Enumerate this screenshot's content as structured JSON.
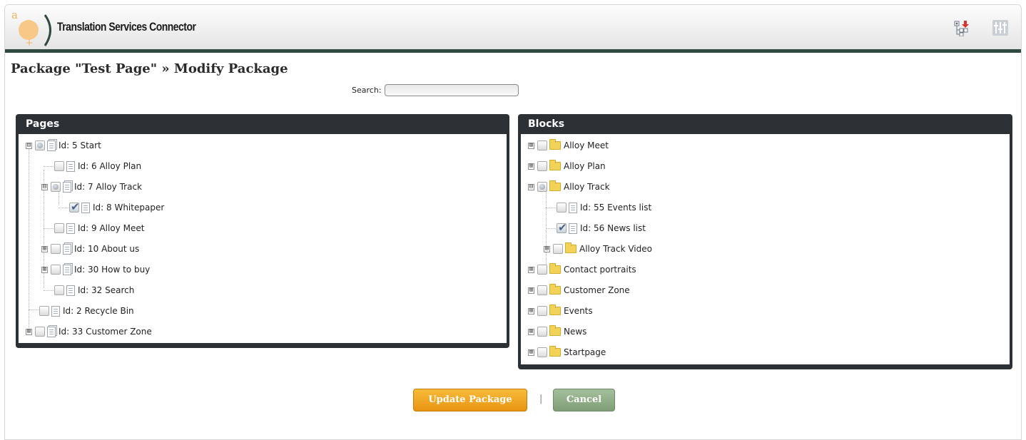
{
  "header": {
    "app_title": "Translation Services Connector",
    "logo_letter": "a",
    "icons": [
      "tree-download-icon",
      "settings-sliders-icon"
    ]
  },
  "page": {
    "title": "Package \"Test Page\" » Modify Package",
    "search_label": "Search:",
    "search_value": ""
  },
  "pages_panel": {
    "title": "Pages",
    "nodes": [
      {
        "label": "Id: 5 Start",
        "expander": "⊟",
        "check": "partial",
        "icon": "multi-page-icon"
      },
      {
        "label": "Id: 6 Alloy Plan",
        "expander": "",
        "check": "none",
        "icon": "page-icon"
      },
      {
        "label": "Id: 7 Alloy Track",
        "expander": "⊟",
        "check": "partial",
        "icon": "multi-page-icon"
      },
      {
        "label": "Id: 8 Whitepaper",
        "expander": "",
        "check": "checked",
        "icon": "page-icon"
      },
      {
        "label": "Id: 9 Alloy Meet",
        "expander": "",
        "check": "none",
        "icon": "page-icon"
      },
      {
        "label": "Id: 10 About us",
        "expander": "⊞",
        "check": "none",
        "icon": "multi-page-icon"
      },
      {
        "label": "Id: 30 How to buy",
        "expander": "⊞",
        "check": "none",
        "icon": "multi-page-icon"
      },
      {
        "label": "Id: 32 Search",
        "expander": "",
        "check": "none",
        "icon": "page-icon"
      },
      {
        "label": "Id: 2 Recycle Bin",
        "expander": "",
        "check": "none",
        "icon": "page-icon"
      },
      {
        "label": "Id: 33 Customer Zone",
        "expander": "⊞",
        "check": "none",
        "icon": "multi-page-icon"
      }
    ]
  },
  "blocks_panel": {
    "title": "Blocks",
    "nodes": [
      {
        "label": "Alloy Meet",
        "expander": "⊞",
        "check": "none",
        "icon": "folder-icon"
      },
      {
        "label": "Alloy Plan",
        "expander": "⊞",
        "check": "none",
        "icon": "folder-icon"
      },
      {
        "label": "Alloy Track",
        "expander": "⊟",
        "check": "partial",
        "icon": "folder-icon"
      },
      {
        "label": "Id: 55 Events list",
        "expander": "",
        "check": "none",
        "icon": "page-icon"
      },
      {
        "label": "Id: 56 News list",
        "expander": "",
        "check": "checked",
        "icon": "page-icon"
      },
      {
        "label": "Alloy Track Video",
        "expander": "⊞",
        "check": "none",
        "icon": "folder-icon"
      },
      {
        "label": "Contact portraits",
        "expander": "⊞",
        "check": "none",
        "icon": "folder-icon"
      },
      {
        "label": "Customer Zone",
        "expander": "⊞",
        "check": "none",
        "icon": "folder-icon"
      },
      {
        "label": "Events",
        "expander": "⊞",
        "check": "none",
        "icon": "folder-icon"
      },
      {
        "label": "News",
        "expander": "⊞",
        "check": "none",
        "icon": "folder-icon"
      },
      {
        "label": "Startpage",
        "expander": "⊞",
        "check": "none",
        "icon": "folder-icon"
      }
    ]
  },
  "actions": {
    "update_label": "Update Package",
    "separator": "|",
    "cancel_label": "Cancel"
  }
}
